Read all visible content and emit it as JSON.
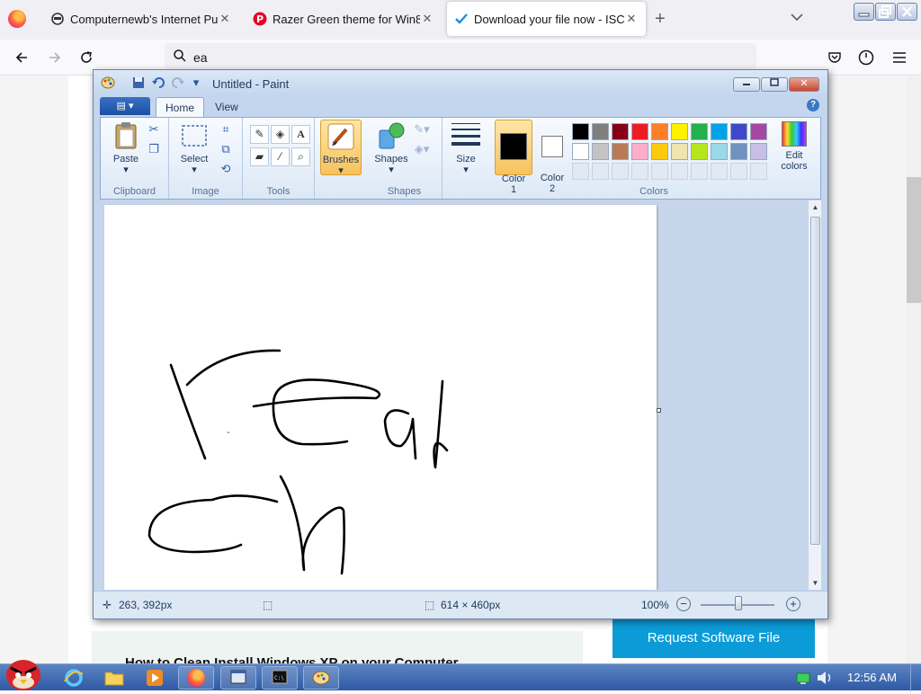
{
  "browser": {
    "tabs": [
      {
        "title": "Computernewb's Internet Pu",
        "icon": "spy-icon"
      },
      {
        "title": "Razer Green theme for Win8,",
        "icon": "pinterest-icon"
      },
      {
        "title": "Download your file now - ISC",
        "icon": "checkmark-icon",
        "active": true
      }
    ],
    "url_text": "ea"
  },
  "page": {
    "article_link": "How to Clean Install Windows XP on your Computer",
    "request_button": "Request Software File",
    "accent_color": "#0b9cd8"
  },
  "paint": {
    "title": "Untitled - Paint",
    "file_menu_label": "▤ ▾",
    "tabs": [
      "Home",
      "View"
    ],
    "groups": {
      "clipboard": {
        "label": "Clipboard",
        "paste": "Paste"
      },
      "image": {
        "label": "Image",
        "select": "Select"
      },
      "tools": {
        "label": "Tools"
      },
      "brushes": {
        "label": "Brushes"
      },
      "shapes": {
        "label": "Shapes",
        "shapes_btn": "Shapes"
      },
      "size": {
        "label": "Size"
      },
      "colors": {
        "label": "Colors",
        "color1": "Color\n1",
        "color2": "Color\n2",
        "edit": "Edit colors"
      }
    },
    "palette_row1": [
      "#000000",
      "#7f7f7f",
      "#880015",
      "#ed1c24",
      "#ff7f27",
      "#fff200",
      "#22b14c",
      "#00a2e8",
      "#3f48cc",
      "#a349a4"
    ],
    "palette_row2": [
      "#ffffff",
      "#c3c3c3",
      "#b97a57",
      "#ffaec9",
      "#ffc90e",
      "#efe4b0",
      "#b5e61d",
      "#99d9ea",
      "#7092be",
      "#c8bfe7"
    ],
    "color1_value": "#000000",
    "color2_value": "#ffffff",
    "status": {
      "position": "263, 392px",
      "image_size": "614 × 460px",
      "zoom": "100%"
    }
  },
  "taskbar": {
    "clock": "12:56 AM"
  }
}
